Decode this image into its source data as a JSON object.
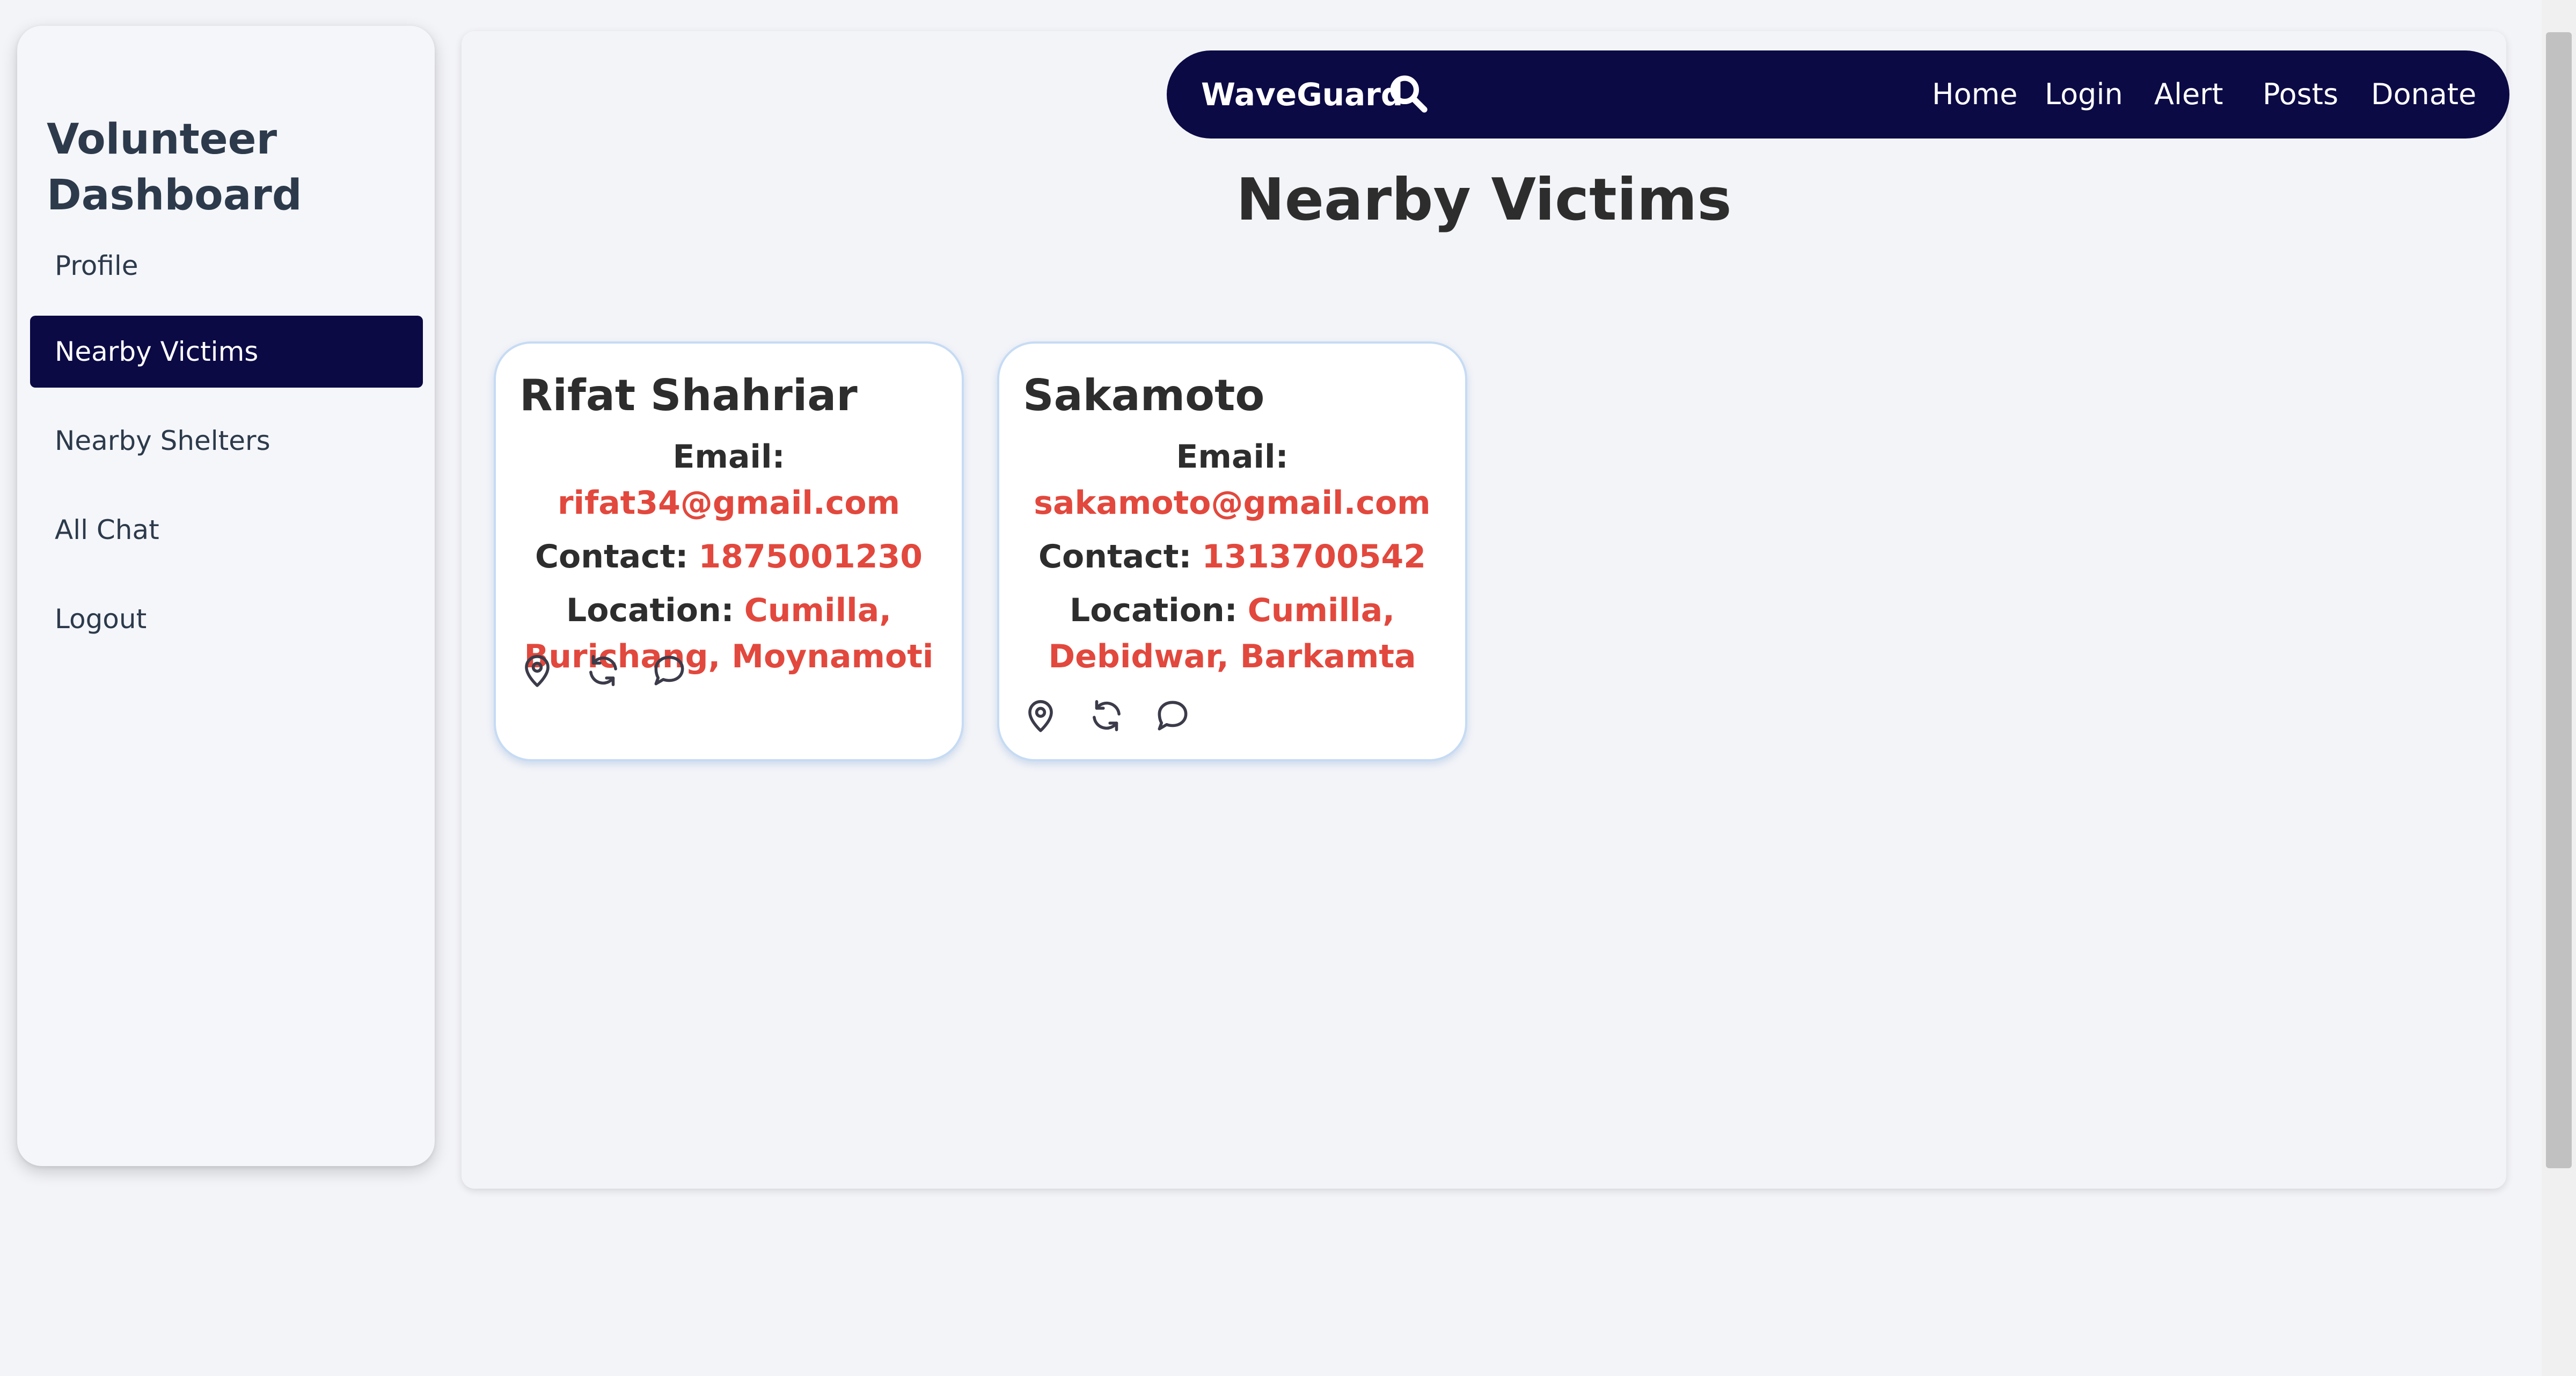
{
  "sidebar": {
    "title": "Volunteer Dashboard",
    "items": [
      {
        "label": "Profile"
      },
      {
        "label": "Nearby Victims"
      },
      {
        "label": "Nearby Shelters"
      },
      {
        "label": "All Chat"
      },
      {
        "label": "Logout"
      }
    ],
    "active_index": 1
  },
  "navbar": {
    "brand": "WaveGuard",
    "links": [
      "Home",
      "Login",
      "Alert",
      "Posts",
      "Donate"
    ]
  },
  "page": {
    "title": "Nearby Victims"
  },
  "labels": {
    "email": "Email:",
    "contact": "Contact:",
    "location": "Location:"
  },
  "victims": [
    {
      "name": "Rifat Shahriar",
      "email": "rifat34@gmail.com",
      "contact": "1875001230",
      "location": "Cumilla, Burichang, Moynamoti"
    },
    {
      "name": "Sakamoto",
      "email": "sakamoto@gmail.com",
      "contact": "1313700542",
      "location": "Cumilla, Debidwar, Barkamta"
    }
  ],
  "colors": {
    "primary": "#0b0a45",
    "accent": "#e2483d",
    "background": "#f3f4f8"
  },
  "card_icons": [
    "location-pin-icon",
    "refresh-icon",
    "chat-bubble-icon"
  ]
}
